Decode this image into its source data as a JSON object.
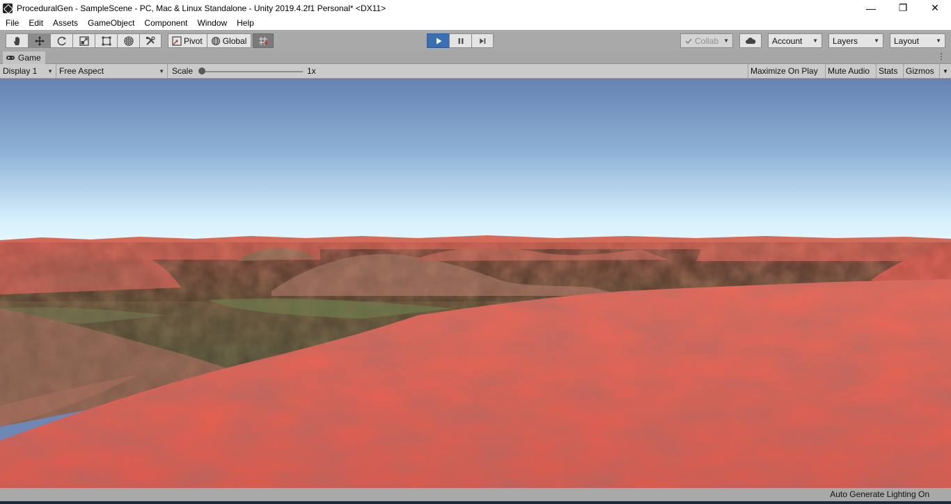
{
  "window": {
    "title": "ProceduralGen - SampleScene - PC, Mac & Linux Standalone - Unity 2019.4.2f1 Personal* <DX11>",
    "minimize": "—",
    "maximize": "❐",
    "close": "✕"
  },
  "menu": {
    "items": [
      "File",
      "Edit",
      "Assets",
      "GameObject",
      "Component",
      "Window",
      "Help"
    ]
  },
  "toolbar": {
    "tools": [
      "hand-tool-icon",
      "move-tool-icon",
      "rotate-tool-icon",
      "scale-tool-icon",
      "rect-tool-icon",
      "transform-tool-icon",
      "custom-tool-icon"
    ],
    "active_tool": "move-tool-icon",
    "pivot_label": "Pivot",
    "global_label": "Global",
    "collab_label": "Collab",
    "account_label": "Account",
    "layers_label": "Layers",
    "layout_label": "Layout",
    "play_active": true
  },
  "game_view": {
    "tab_label": "Game",
    "display_label": "Display 1",
    "aspect_label": "Free Aspect",
    "scale_label": "Scale",
    "scale_value": "1x",
    "maximize_on_play": "Maximize On Play",
    "mute_audio": "Mute Audio",
    "stats": "Stats",
    "gizmos": "Gizmos"
  },
  "status": {
    "lighting_text": "Auto Generate Lighting On"
  },
  "colors": {
    "sky_top": "#6a86b4",
    "sky_horizon": "#d9f2ff",
    "terrain_red": "#e8604f",
    "terrain_green": "#6f7f4b",
    "play_accent": "#3b6fb4"
  }
}
